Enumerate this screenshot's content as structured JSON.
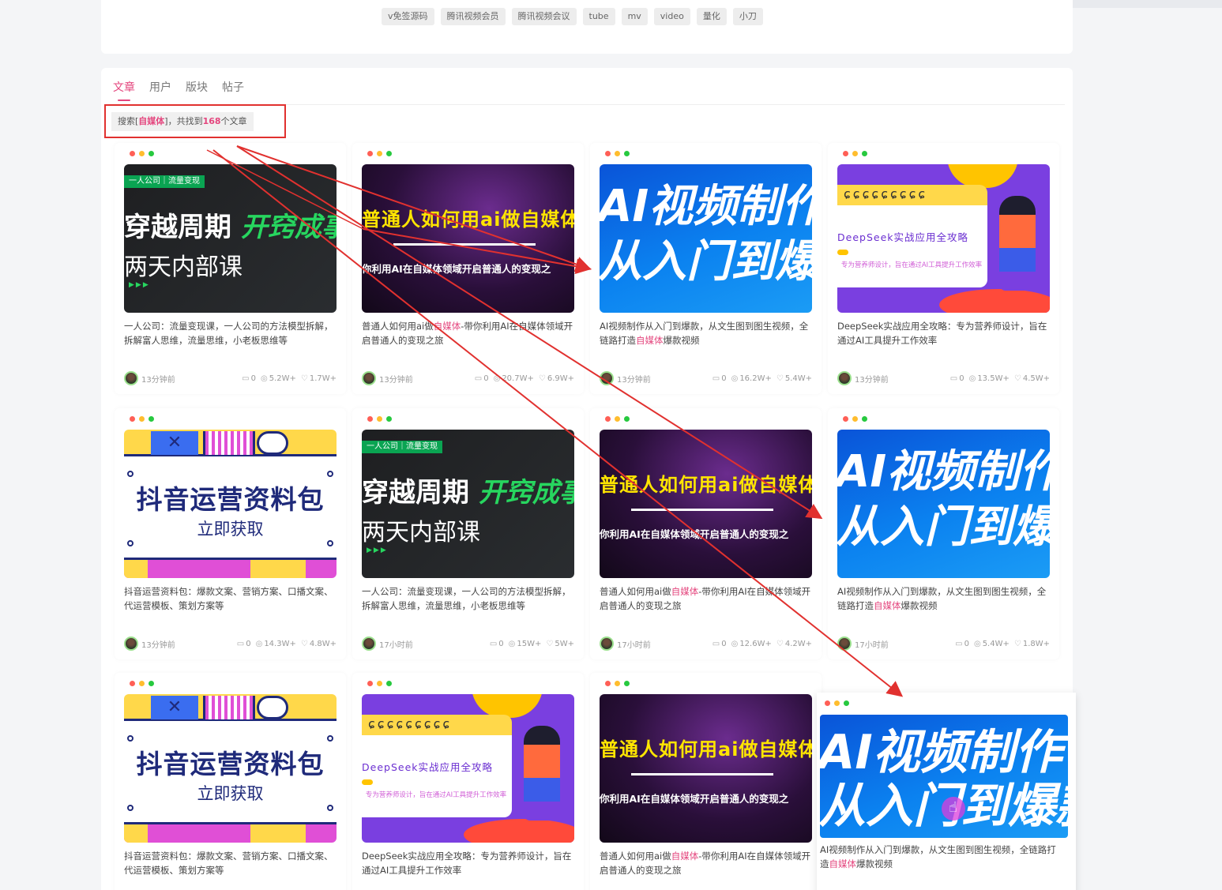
{
  "tags": [
    "v免签源码",
    "腾讯视频会员",
    "腾讯视频会议",
    "tube",
    "mv",
    "video",
    "量化",
    "小刀"
  ],
  "tabs": [
    {
      "label": "文章",
      "active": true
    },
    {
      "label": "用户",
      "active": false
    },
    {
      "label": "版块",
      "active": false
    },
    {
      "label": "帖子",
      "active": false
    }
  ],
  "summary": {
    "prefix": "搜索[",
    "keyword": "自媒体",
    "middle": "]，共找到",
    "count": "168",
    "suffix": "个文章"
  },
  "accent_color": "#e4467e",
  "annotation_color": "#e1312f",
  "thumb_text": {
    "green": {
      "badge": "一人公司｜流量变现",
      "line1a": "穿越周期",
      "line1b": "开窍成事",
      "line2": "两天内部课",
      "arrows": "▶▶▶"
    },
    "purple": {
      "line1": "普通人如何用ai做自媒体",
      "line2": "你利用AI在自媒体领域开启普通人的变现之"
    },
    "blue": {
      "line1": "AI视频制作",
      "line2": "从入门到爆款"
    },
    "deepseek": {
      "rings": "ɕɕɕɕɕɕɕɕɕ",
      "title": "DeepSeek实战应用全攻略",
      "sub": "专为营养师设计，旨在通过AI工具提升工作效率"
    },
    "douyin": {
      "title": "抖音运营资料包",
      "sub": "立即获取"
    }
  },
  "cards": [
    {
      "thumb": "green",
      "title_html": [
        "一人公司：流量变现课，一人公司的方法模型拆解， 拆解富人思维，流量思维，小老板思维等"
      ],
      "time": "13分钟前",
      "comments": "0",
      "views": "5.2W+",
      "likes": "1.7W+"
    },
    {
      "thumb": "purple",
      "title_pre": "普通人如何用ai做",
      "title_hl": "自媒体",
      "title_post": "-带你利用AI在自媒体领域开启普通人的变现之旅",
      "time": "13分钟前",
      "comments": "0",
      "views": "20.7W+",
      "likes": "6.9W+"
    },
    {
      "thumb": "blue",
      "title_pre": "AI视频制作从入门到爆款，从文生图到图生视频，全链路打造",
      "title_hl": "自媒体",
      "title_post": "爆款视频",
      "time": "13分钟前",
      "comments": "0",
      "views": "16.2W+",
      "likes": "5.4W+"
    },
    {
      "thumb": "deepseek",
      "title_pre": "DeepSeek实战应用全攻略：专为营养师设计，旨在通过AI工具提升工作效率",
      "title_hl": "",
      "title_post": "",
      "time": "13分钟前",
      "comments": "0",
      "views": "13.5W+",
      "likes": "4.5W+"
    },
    {
      "thumb": "douyin",
      "title_pre": "抖音运营资料包：爆款文案、营销方案、口播文案、代运营模板、策划方案等",
      "title_hl": "",
      "title_post": "",
      "time": "13分钟前",
      "comments": "0",
      "views": "14.3W+",
      "likes": "4.8W+"
    },
    {
      "thumb": "green",
      "title_pre": "一人公司：流量变现课，一人公司的方法模型拆解， 拆解富人思维，流量思维，小老板思维等",
      "title_hl": "",
      "title_post": "",
      "time": "17小时前",
      "comments": "0",
      "views": "15W+",
      "likes": "5W+"
    },
    {
      "thumb": "purple",
      "title_pre": "普通人如何用ai做",
      "title_hl": "自媒体",
      "title_post": "-带你利用AI在自媒体领域开启普通人的变现之旅",
      "time": "17小时前",
      "comments": "0",
      "views": "12.6W+",
      "likes": "4.2W+"
    },
    {
      "thumb": "blue",
      "title_pre": "AI视频制作从入门到爆款，从文生图到图生视频，全链路打造",
      "title_hl": "自媒体",
      "title_post": "爆款视频",
      "time": "17小时前",
      "comments": "0",
      "views": "5.4W+",
      "likes": "1.8W+"
    },
    {
      "thumb": "douyin",
      "title_pre": "抖音运营资料包：爆款文案、营销方案、口播文案、代运营模板、策划方案等",
      "title_hl": "",
      "title_post": ""
    },
    {
      "thumb": "deepseek",
      "title_pre": "DeepSeek实战应用全攻略：专为营养师设计，旨在通过AI工具提升工作效率",
      "title_hl": "",
      "title_post": ""
    },
    {
      "thumb": "purple",
      "title_pre": "普通人如何用ai做",
      "title_hl": "自媒体",
      "title_post": "-带你利用AI在自媒体领域开启普通人的变现之旅"
    }
  ],
  "ghost_card": {
    "thumb": "blue",
    "title_pre": "AI视频制作从入门到爆款，从文生图到图生视频，全链路打造",
    "title_hl": "自媒体",
    "title_post": "爆款视频"
  },
  "icons": {
    "comment": "comment-icon",
    "view": "eye-icon",
    "like": "thumb-up-icon",
    "cursor": "hand-pointer-icon"
  }
}
